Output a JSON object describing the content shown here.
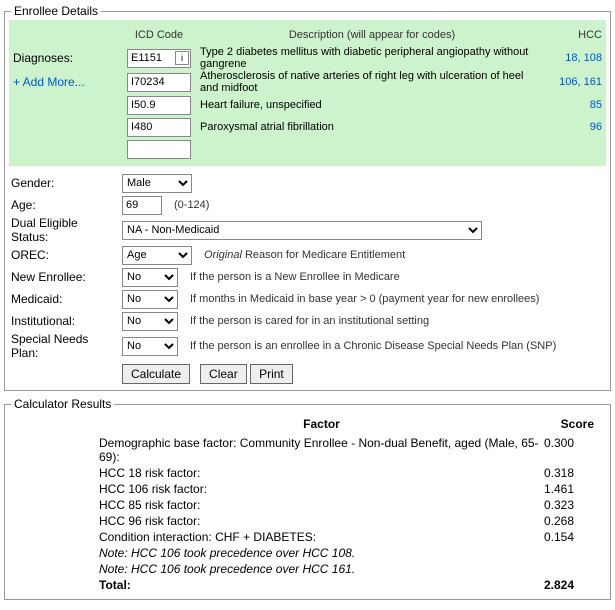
{
  "enrollee": {
    "legend": "Enrollee Details",
    "headers": {
      "icd": "ICD Code",
      "desc": "Description (will appear for codes)",
      "hcc": "HCC"
    },
    "diag_label": "Diagnoses:",
    "add_more": "+ Add More...",
    "diagnoses": [
      {
        "code": "E1151",
        "desc": "Type 2 diabetes mellitus with diabetic peripheral angiopathy without gangrene",
        "hcc": "18, 108",
        "info": true
      },
      {
        "code": "I70234",
        "desc": "Atherosclerosis of native arteries of right leg with ulceration of heel and midfoot",
        "hcc": "106, 161"
      },
      {
        "code": "I50.9",
        "desc": "Heart failure, unspecified",
        "hcc": "85"
      },
      {
        "code": "I480",
        "desc": "Paroxysmal atrial fibrillation",
        "hcc": "96"
      },
      {
        "code": "",
        "desc": "",
        "hcc": ""
      }
    ],
    "gender": {
      "label": "Gender:",
      "value": "Male"
    },
    "age": {
      "label": "Age:",
      "value": "69",
      "range": "(0-124)"
    },
    "dual": {
      "label": "Dual Eligible Status:",
      "value": "NA - Non-Medicaid"
    },
    "orec": {
      "label": "OREC:",
      "value": "Age",
      "hint_prefix": "Original",
      "hint_rest": " Reason for Medicare Entitlement"
    },
    "newEnrollee": {
      "label": "New Enrollee:",
      "value": "No",
      "hint": "If the person is a New Enrollee in Medicare"
    },
    "medicaid": {
      "label": "Medicaid:",
      "value": "No",
      "hint": "If months in Medicaid in base year > 0 (payment year for new enrollees)"
    },
    "institutional": {
      "label": "Institutional:",
      "value": "No",
      "hint": "If the person is cared for in an institutional setting"
    },
    "snp": {
      "label": "Special Needs Plan:",
      "value": "No",
      "hint": "If the person is an enrollee in a Chronic Disease Special Needs Plan (SNP)"
    },
    "buttons": {
      "calc": "Calculate",
      "clear": "Clear",
      "print": "Print"
    }
  },
  "results": {
    "legend": "Calculator Results",
    "headers": {
      "factor": "Factor",
      "score": "Score"
    },
    "rows": [
      {
        "f": "Demographic base factor: Community Enrollee - Non-dual Benefit, aged (Male, 65-69):",
        "s": "0.300"
      },
      {
        "f": "HCC 18 risk factor:",
        "s": "0.318"
      },
      {
        "f": "HCC 106 risk factor:",
        "s": "1.461"
      },
      {
        "f": "HCC 85 risk factor:",
        "s": "0.323"
      },
      {
        "f": "HCC 96 risk factor:",
        "s": "0.268"
      },
      {
        "f": "Condition interaction: CHF + DIABETES:",
        "s": "0.154"
      }
    ],
    "notes": [
      "Note: HCC 106 took precedence over HCC 108.",
      "Note: HCC 106 took precedence over HCC 161."
    ],
    "total": {
      "label": "Total:",
      "value": "2.824"
    }
  }
}
